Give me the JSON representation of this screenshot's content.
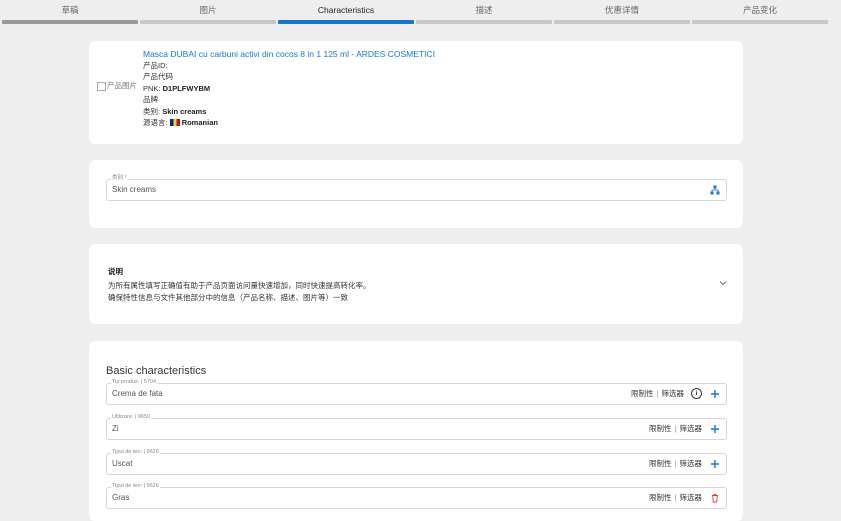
{
  "tabs": [
    {
      "label": "草稿"
    },
    {
      "label": "图片"
    },
    {
      "label": "Characteristics"
    },
    {
      "label": "描述"
    },
    {
      "label": "优惠详情"
    },
    {
      "label": "产品变化"
    }
  ],
  "product": {
    "image_alt": "产品图片",
    "title": "Masca DUBAI cu carbuni activi din cocos 8 in 1 125 ml - ARDES COSMETICI",
    "id_label": "产品ID:",
    "code_label": "产品代码",
    "pnk_label": "PNK:",
    "pnk_value": "D1PLFWYBM",
    "brand_label": "品牌",
    "category_label": "类别:",
    "category_value": "Skin creams",
    "source_lang_label": "源语言:",
    "source_lang_value": "Romanian"
  },
  "category_field": {
    "label": "类别 *",
    "value": "Skin creams"
  },
  "description": {
    "heading": "说明",
    "line1": "为所有属性填写正确值有助于产品页面访问量快速增加，同时快速提高转化率。",
    "line2": "确保特性信息与文件其他部分中的信息（产品名称、描述、图片等）一致"
  },
  "basic": {
    "title": "Basic characteristics",
    "restrict_label": "限制性",
    "filter_label": "筛选器",
    "fields": [
      {
        "label": "Tip produs: | 5704",
        "value": "Crema de fata"
      },
      {
        "label": "Utilizare: | 9650",
        "value": "Zi"
      },
      {
        "label": "Tipul de ten: | 9626",
        "value": "Uscat"
      },
      {
        "label": "Tipul de ten: | 9626",
        "value": "Gras"
      }
    ]
  },
  "colors": {
    "accent": "#1677d2",
    "danger": "#e53935"
  }
}
